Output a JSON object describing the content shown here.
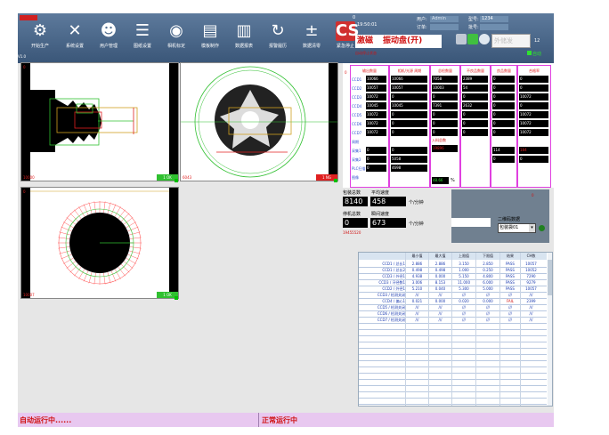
{
  "toolbar": {
    "version_label": "V1.0",
    "buttons": [
      {
        "label": "开始生产",
        "icon": "film-reel-icon"
      },
      {
        "label": "系统设置",
        "icon": "tools-icon"
      },
      {
        "label": "用户管理",
        "icon": "user-icon"
      },
      {
        "label": "图纸设置",
        "icon": "database-icon"
      },
      {
        "label": "相机标定",
        "icon": "camera-icon"
      },
      {
        "label": "模板制作",
        "icon": "template-icon"
      },
      {
        "label": "数据报表",
        "icon": "report-icon"
      },
      {
        "label": "报警履历",
        "icon": "alarm-history-icon"
      },
      {
        "label": "数据清零",
        "icon": "calculator-icon"
      },
      {
        "label": "紧急停止",
        "icon": "emergency-stop-icon",
        "icon_text": "CS"
      }
    ]
  },
  "info": {
    "time": "19:50:01",
    "user_label": "用户:",
    "user_value": "Admin",
    "order_label": "订单:",
    "model_label": "型号:",
    "model_value": "1234",
    "batch_label": "批号:",
    "mode1": "激磁",
    "mode2": "振动盘(开)",
    "status_line": "自动停止状态",
    "output_label": "外储发",
    "auto_label": "自动",
    "num_right": "12",
    "num_top": "0"
  },
  "cameras": [
    {
      "id": "cam1",
      "corner": "10000",
      "status": "1 OK"
    },
    {
      "id": "cam2",
      "corner": "6043",
      "status": "1 NG"
    },
    {
      "id": "cam3",
      "corner": "10007",
      "status": "1 OK"
    }
  ],
  "data_panel": {
    "headers": [
      "输出数量",
      "相机/光源 周期",
      "总检数量",
      "不良品数量",
      "良品数量",
      "合格率"
    ],
    "rows": [
      "CCD1",
      "CCD2",
      "CCD3",
      "CCD4",
      "CCD5",
      "CCD6",
      "CCD7",
      "周期",
      "采集1",
      "采集2",
      "PLC扫描",
      "图像"
    ],
    "col1": [
      "10066",
      "10057",
      "10072",
      "10045",
      "10072",
      "10072",
      "10072",
      "",
      "0",
      "0",
      "0"
    ],
    "col2": [
      "10066",
      "10057",
      "0",
      "10045",
      "0",
      "0",
      "0",
      "",
      "0",
      "5058",
      "4698"
    ],
    "col3": [
      "7058",
      "10003",
      "0",
      "7391",
      "0",
      "0",
      "0"
    ],
    "col3_extra_label": "入料总数",
    "col3_extra_value": "19896",
    "col3_pct": "48.66",
    "col3_pct_unit": "%",
    "col4": [
      "2389",
      "54",
      "0",
      "2632",
      "0",
      "0",
      "0"
    ],
    "col5": [
      "0",
      "0",
      "0",
      "0",
      "0",
      "0",
      "0",
      "",
      "114",
      "0"
    ],
    "col6": [
      "0",
      "0",
      "10072",
      "0",
      "10072",
      "10072",
      "10072",
      "",
      "184",
      "0"
    ]
  },
  "stats": {
    "total_label": "包装总数",
    "speed_label": "平均速度",
    "total": "8140",
    "speed": "458",
    "speed_unit": "个/分钟",
    "stop_label": "停机总数",
    "rate_label": "瞬间速度",
    "stop": "0",
    "rate": "673",
    "rate_unit": "个/分钟",
    "bottom_num": "19455520",
    "select_label": "二维码数据",
    "select_value": "包装袋01",
    "right_num": "0"
  },
  "table": {
    "headers": [
      "",
      "最小值",
      "最大值",
      "上限值",
      "下限值",
      "结果",
      "CH数"
    ],
    "rows": [
      [
        "CCD1 / 总长1",
        "2.886",
        "2.886",
        "3.150",
        "2.850",
        "PASS",
        "10057"
      ],
      [
        "CCD1 / 总长2",
        "0.498",
        "0.498",
        "1.000",
        "0.250",
        "PASS",
        "10052"
      ],
      [
        "CCD3 / 外径1",
        "4.938",
        "0.000",
        "5.150",
        "4.800",
        "PASS",
        "7290"
      ],
      [
        "CCD3 / 牙径数1",
        "3.006",
        "8.153",
        "11.000",
        "6.000",
        "PASS",
        "9279"
      ],
      [
        "CCD2 / 外径1",
        "5.210",
        "0.040",
        "5.300",
        "5.000",
        "PASS",
        "10057"
      ],
      [
        "CCD3 / 检测关闭",
        "///",
        "///",
        "///",
        "///",
        "///",
        "///"
      ],
      [
        "CCD4 / 偏心1",
        "0.021",
        "0.000",
        "0.020",
        "0.000",
        "FAIL",
        "2399"
      ],
      [
        "CCD5 / 检测关闭",
        "///",
        "///",
        "///",
        "///",
        "///",
        "///"
      ],
      [
        "CCD6 / 检测关闭",
        "///",
        "///",
        "///",
        "///",
        "///",
        "///"
      ],
      [
        "CCD7 / 检测关闭",
        "///",
        "///",
        "///",
        "///",
        "///",
        "///"
      ]
    ]
  },
  "status": {
    "left": "自动运行中......",
    "right": "正常运行中"
  },
  "colors": {
    "accent": "#3a5678",
    "red": "#d01010",
    "ok": "#30c030"
  }
}
